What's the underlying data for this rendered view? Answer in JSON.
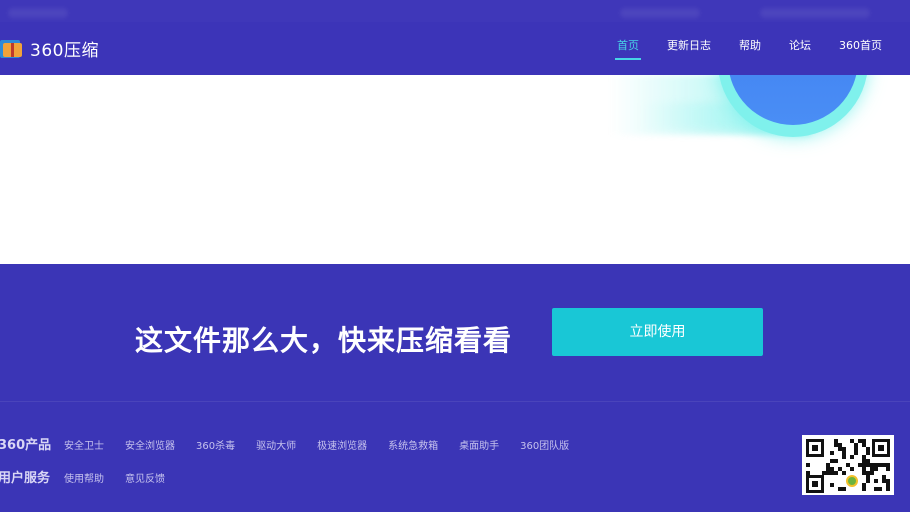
{
  "app": {
    "logo_text": "360压缩"
  },
  "nav": {
    "items": [
      {
        "label": "首页",
        "active": true
      },
      {
        "label": "更新日志",
        "active": false
      },
      {
        "label": "帮助",
        "active": false
      },
      {
        "label": "论坛",
        "active": false
      },
      {
        "label": "360首页",
        "active": false
      }
    ]
  },
  "cta": {
    "headline": "这文件那么大，快来压缩看看",
    "button_label": "立即使用"
  },
  "footer": {
    "products": {
      "title": "360产品",
      "links": [
        "安全卫士",
        "安全浏览器",
        "360杀毒",
        "驱动大师",
        "极速浏览器",
        "系统急救箱",
        "桌面助手",
        "360团队版"
      ]
    },
    "services": {
      "title": "用户服务",
      "links": [
        "使用帮助",
        "意见反馈"
      ]
    }
  },
  "colors": {
    "background": "#3b35b6",
    "accent_cyan": "#19c7d6",
    "nav_active": "#47d4e6",
    "banner": "#ffffff"
  },
  "icons": {
    "logo": "archive-box-icon",
    "qr": "qr-code-icon"
  }
}
